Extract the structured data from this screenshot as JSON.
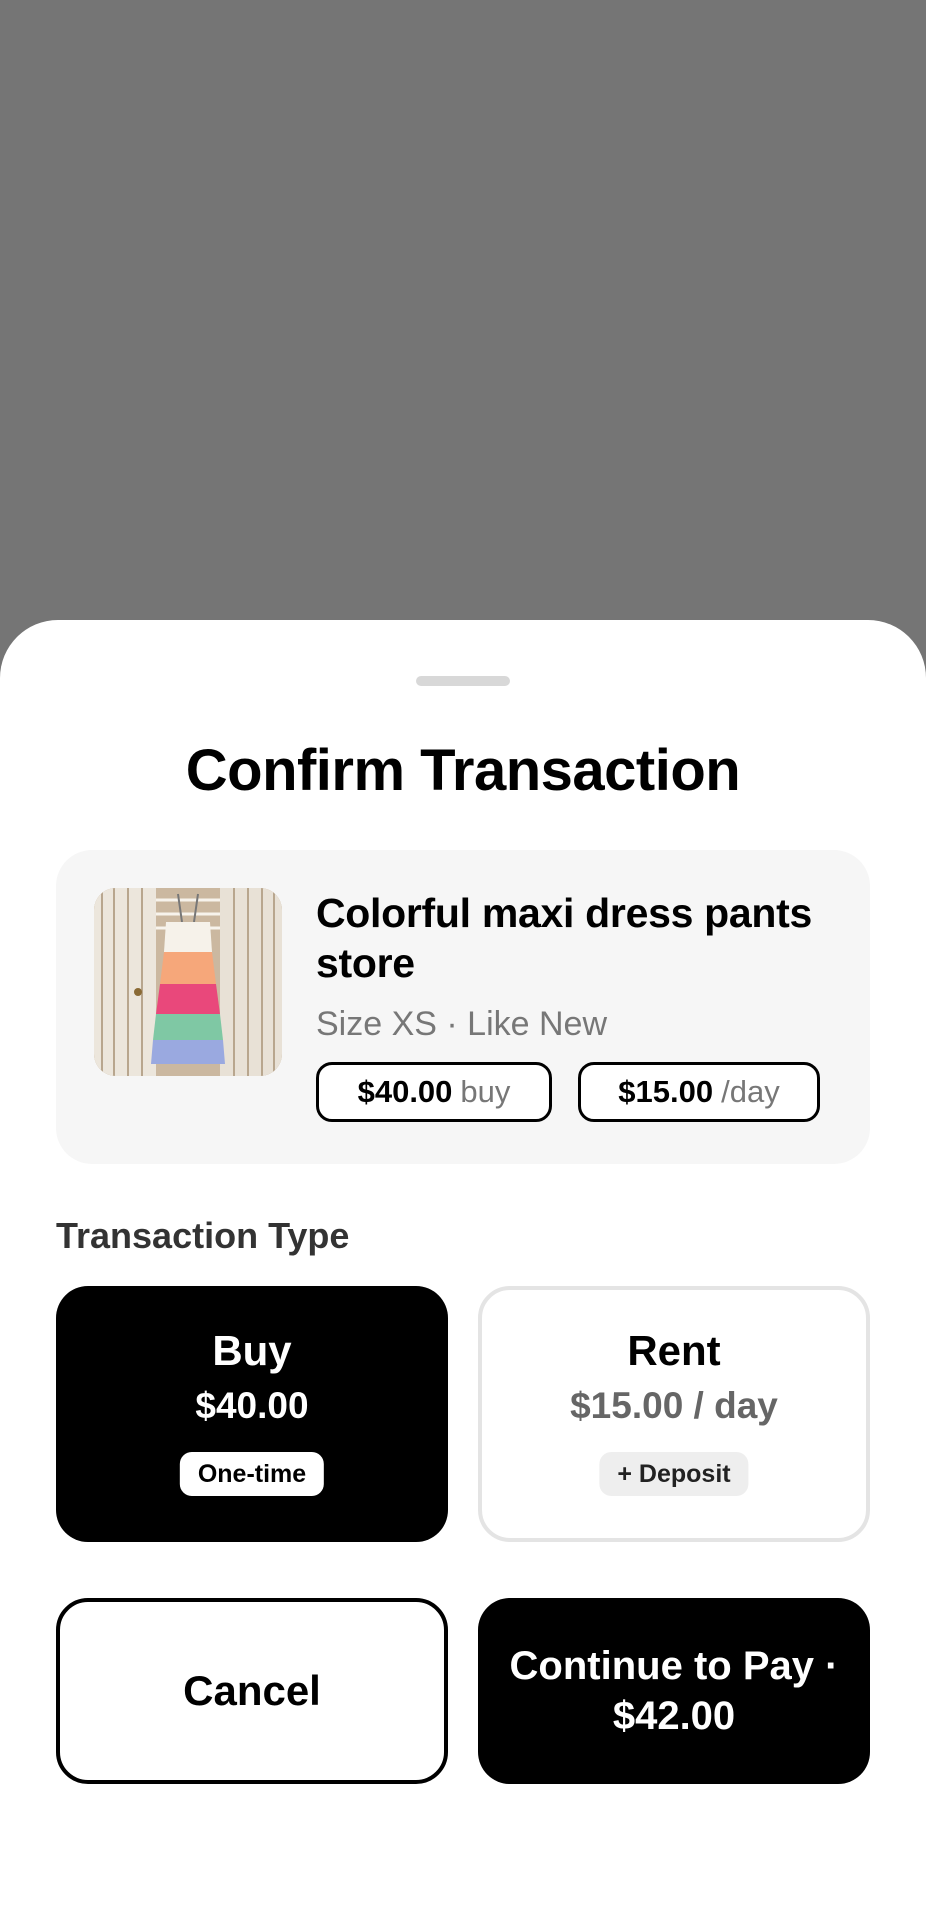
{
  "sheet": {
    "title": "Confirm Transaction"
  },
  "item": {
    "name": "Colorful maxi dress pants store",
    "meta": "Size XS · Like New",
    "buy_price": "$40.00",
    "buy_unit": "buy",
    "rent_price": "$15.00",
    "rent_unit": "/day"
  },
  "transaction_type": {
    "label": "Transaction Type",
    "options": [
      {
        "name": "Buy",
        "price": "$40.00",
        "badge": "One-time",
        "selected": true
      },
      {
        "name": "Rent",
        "price": "$15.00 / day",
        "badge": "+ Deposit",
        "selected": false
      }
    ]
  },
  "actions": {
    "cancel_label": "Cancel",
    "continue_label": "Continue to Pay · $42.00"
  },
  "colors": {
    "backdrop": "#757575",
    "selected": "#000000",
    "muted_text": "#777777"
  }
}
